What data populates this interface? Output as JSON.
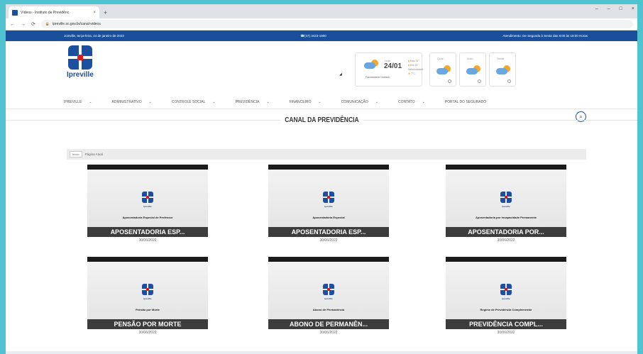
{
  "browser": {
    "tab_title": "Vídeos - Instituto de Previdênc",
    "tab_close": "×",
    "new_tab": "+",
    "url": "ipreville.sc.gov.br/canal-videos",
    "win_min": "–",
    "win_restore": "–",
    "win_max": "□",
    "win_close": "×"
  },
  "topbar": {
    "date": "Joinville, terça-feira, 24 de janeiro de 2023",
    "phone": "(47) 3423-1900",
    "hours": "Atendimento: De Segunda à Sexta das 8:00 às 18:00 Horas"
  },
  "logo": {
    "text": "Ipreville"
  },
  "weather": {
    "today_label": "Hoje",
    "today_date": "24/01",
    "place": "Parcialmente Nublado",
    "temp_max": "Máx 31°",
    "temp_min": "Mín 21°",
    "rain_label": "Nebulosidade",
    "rain_value": "7°C",
    "days": [
      "Quar",
      "Quin",
      "Sexta"
    ]
  },
  "nav": {
    "items": [
      "IPREVILLE",
      "ADMINISTRATIVO",
      "CONTROLE SOCIAL",
      "PREVIDÊNCIA",
      "FINANCEIRO",
      "COMUNICAÇÃO",
      "CONTATO",
      "PORTAL DO SEGURADO"
    ],
    "chevron": "⌄"
  },
  "main": {
    "title": "CANAL DA PREVIDÊNCIA",
    "breadcrumb_home": "Início",
    "breadcrumb_current": "Página Atual"
  },
  "videos": [
    {
      "caption": "Aposentadoria Especial de Professor",
      "title": "APOSENTADORIA ESP...",
      "date": "30/06/2022"
    },
    {
      "caption": "Aposentadoria Especial",
      "title": "APOSENTADORIA ESP...",
      "date": "30/06/2022"
    },
    {
      "caption": "Aposentadoria por Incapacidade Permanente",
      "title": "APOSENTADORIA POR...",
      "date": "30/06/2022"
    },
    {
      "caption": "Pensão por Morte",
      "title": "PENSÃO POR MORTE",
      "date": "30/06/2022"
    },
    {
      "caption": "Abono de Permanência",
      "title": "ABONO DE PERMANÊN...",
      "date": "30/06/2022"
    },
    {
      "caption": "Regime de Previdência Complementar",
      "title": "PREVIDÊNCIA COMPL...",
      "date": "30/06/2022"
    }
  ],
  "thumb_brand": "Ipreville",
  "colors": {
    "brand_blue": "#1a4f9c",
    "brand_red": "#d62020"
  }
}
